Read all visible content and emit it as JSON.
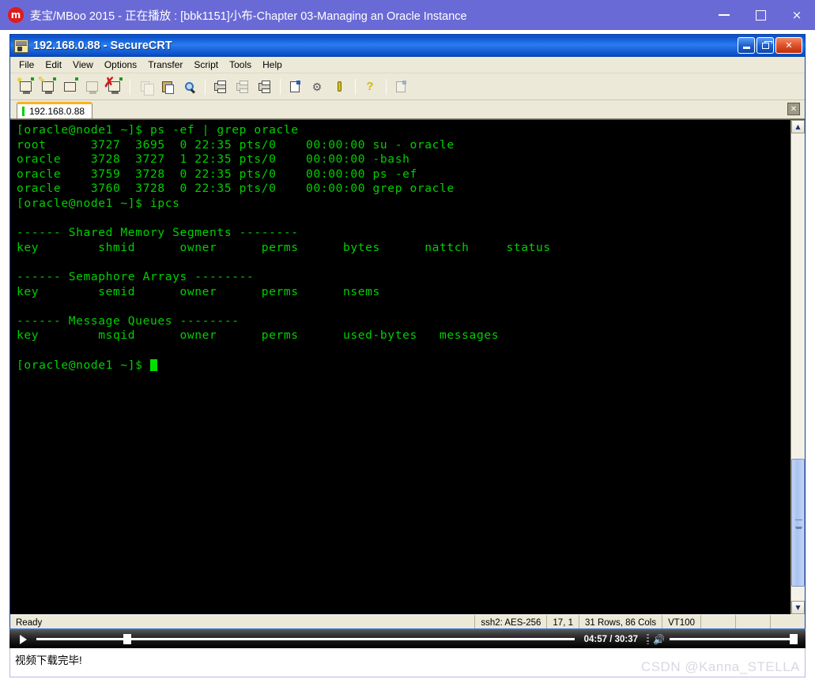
{
  "player_window": {
    "app_icon": "m-logo-icon",
    "title": "麦宝/MBoo 2015 - 正在播放 : [bbk1151]小布-Chapter 03-Managing an Oracle Instance",
    "buttons": {
      "minimize": "minimize-icon",
      "maximize": "maximize-icon",
      "close": "×"
    }
  },
  "securecrt": {
    "title": "192.168.0.88 - SecureCRT",
    "window_buttons": {
      "minimize": "minimize-icon",
      "restore": "restore-icon",
      "close": "✕"
    },
    "menu": [
      "File",
      "Edit",
      "View",
      "Options",
      "Transfer",
      "Script",
      "Tools",
      "Help"
    ],
    "toolbar_icons": [
      "connect-icon",
      "quick-connect-icon",
      "connect-in-tab-icon",
      "connect-sftp-tab-icon",
      "disconnect-icon",
      "copy-icon",
      "paste-icon",
      "find-icon",
      "print-screen-icon",
      "log-session-icon",
      "print-icon",
      "session-options-icon",
      "global-options-icon",
      "key-icon",
      "help-icon",
      "display-icon"
    ],
    "tab": {
      "label": "192.168.0.88",
      "close_label": "✕"
    },
    "terminal": {
      "lines": [
        "[oracle@node1 ~]$ ps -ef | grep oracle",
        "root      3727  3695  0 22:35 pts/0    00:00:00 su - oracle",
        "oracle    3728  3727  1 22:35 pts/0    00:00:00 -bash",
        "oracle    3759  3728  0 22:35 pts/0    00:00:00 ps -ef",
        "oracle    3760  3728  0 22:35 pts/0    00:00:00 grep oracle",
        "[oracle@node1 ~]$ ipcs",
        "",
        "------ Shared Memory Segments --------",
        "key        shmid      owner      perms      bytes      nattch     status",
        "",
        "------ Semaphore Arrays --------",
        "key        semid      owner      perms      nsems",
        "",
        "------ Message Queues --------",
        "key        msqid      owner      perms      used-bytes   messages",
        "",
        "[oracle@node1 ~]$ "
      ],
      "foreground_color": "#00d000",
      "background_color": "#000000",
      "cursor": "block"
    },
    "scrollbar": {
      "up_arrow": "▲",
      "down_arrow": "▼"
    },
    "statusbar": {
      "state": "Ready",
      "cipher": "ssh2: AES-256",
      "cursor_position": "17,  1",
      "dimensions": "31 Rows, 86 Cols",
      "emulation": "VT100"
    }
  },
  "media_controls": {
    "play_label": "play-icon",
    "time_display": "04:57 / 30:37",
    "volume_icon": "🔊",
    "seek_percent": 16,
    "volume_percent": 100
  },
  "bottom": {
    "download_message": "视频下载完毕!",
    "watermark": "CSDN @Kanna_STELLA"
  }
}
